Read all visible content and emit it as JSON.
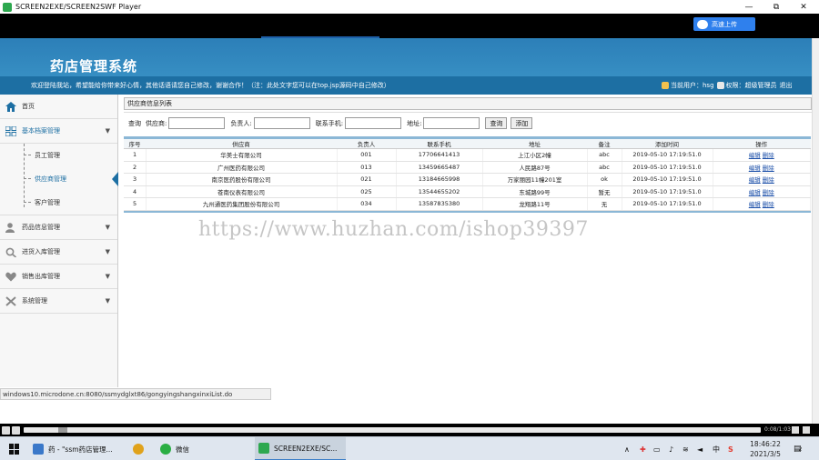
{
  "window": {
    "title": "SCREEN2EXE/SCREEN2SWF Player",
    "minimize": "—",
    "maximize": "⧉",
    "close": "✕",
    "upload_label": "高速上传"
  },
  "app": {
    "title": "药店管理系统",
    "welcome": "欢迎登陆我站，希望能给你带来好心情，其他话语请您自己修改，谢谢合作！（注：此处文字您可以在top.jsp源码中自己修改）",
    "current_user": "当前用户：hsg",
    "permission": "权限：超级管理员",
    "logout": "退出"
  },
  "sidebar": {
    "home": "首页",
    "basic": "基本档案管理",
    "sub": [
      "员工管理",
      "供应商管理",
      "客户管理"
    ],
    "drug": "药品信息管理",
    "stock_in": "进货入库管理",
    "sales_out": "销售出库管理",
    "system": "系统管理"
  },
  "panel": {
    "title": "供应商信息列表",
    "query_label": "查询",
    "supplier_label": "供应商:",
    "contact_label": "负责人:",
    "phone_label": "联系手机:",
    "address_label": "地址:",
    "query_btn": "查询",
    "add_btn": "添加"
  },
  "table": {
    "headers": [
      "序号",
      "供应商",
      "负责人",
      "联系手机",
      "地址",
      "备注",
      "添加时间",
      "操作"
    ],
    "rows": [
      {
        "idx": "1",
        "name": "华美士有限公司",
        "owner": "001",
        "phone": "17706641413",
        "addr": "上江小区2幢",
        "note": "abc",
        "time": "2019-05-10 17:19:51.0"
      },
      {
        "idx": "2",
        "name": "广州医药有限公司",
        "owner": "013",
        "phone": "13459665487",
        "addr": "人民路87号",
        "note": "abc",
        "time": "2019-05-10 17:19:51.0"
      },
      {
        "idx": "3",
        "name": "南京医药股份有限公司",
        "owner": "021",
        "phone": "13184665998",
        "addr": "万家丽园11幢201室",
        "note": "ok",
        "time": "2019-05-10 17:19:51.0"
      },
      {
        "idx": "4",
        "name": "苍南仪表有限公司",
        "owner": "025",
        "phone": "13544655202",
        "addr": "东城路99号",
        "note": "暂无",
        "time": "2019-05-10 17:19:51.0"
      },
      {
        "idx": "5",
        "name": "九州通医药集团股份有限公司",
        "owner": "034",
        "phone": "13587835380",
        "addr": "龙翔路11号",
        "note": "无",
        "time": "2019-05-10 17:19:51.0"
      }
    ],
    "edit_label": "编辑",
    "delete_label": "删除"
  },
  "watermark": "https://www.huzhan.com/ishop39397",
  "status_url": "windows10.microdone.cn:8080/ssmydglxt86/gongyingshangxinxiList.do",
  "player": {
    "timecode": "0:08/1:03"
  },
  "taskbar": {
    "item1": "药 - \"ssm药店管理...",
    "item2": "微信",
    "item3": "SCREEN2EXE/SC...",
    "ime": "中",
    "time": "18:46:22",
    "date": "2021/3/5",
    "notif_count": "2"
  },
  "colors": {
    "header_blue": "#2c7fb8",
    "subbar_blue": "#1d6fa3",
    "link_blue": "#1a4ea8"
  }
}
